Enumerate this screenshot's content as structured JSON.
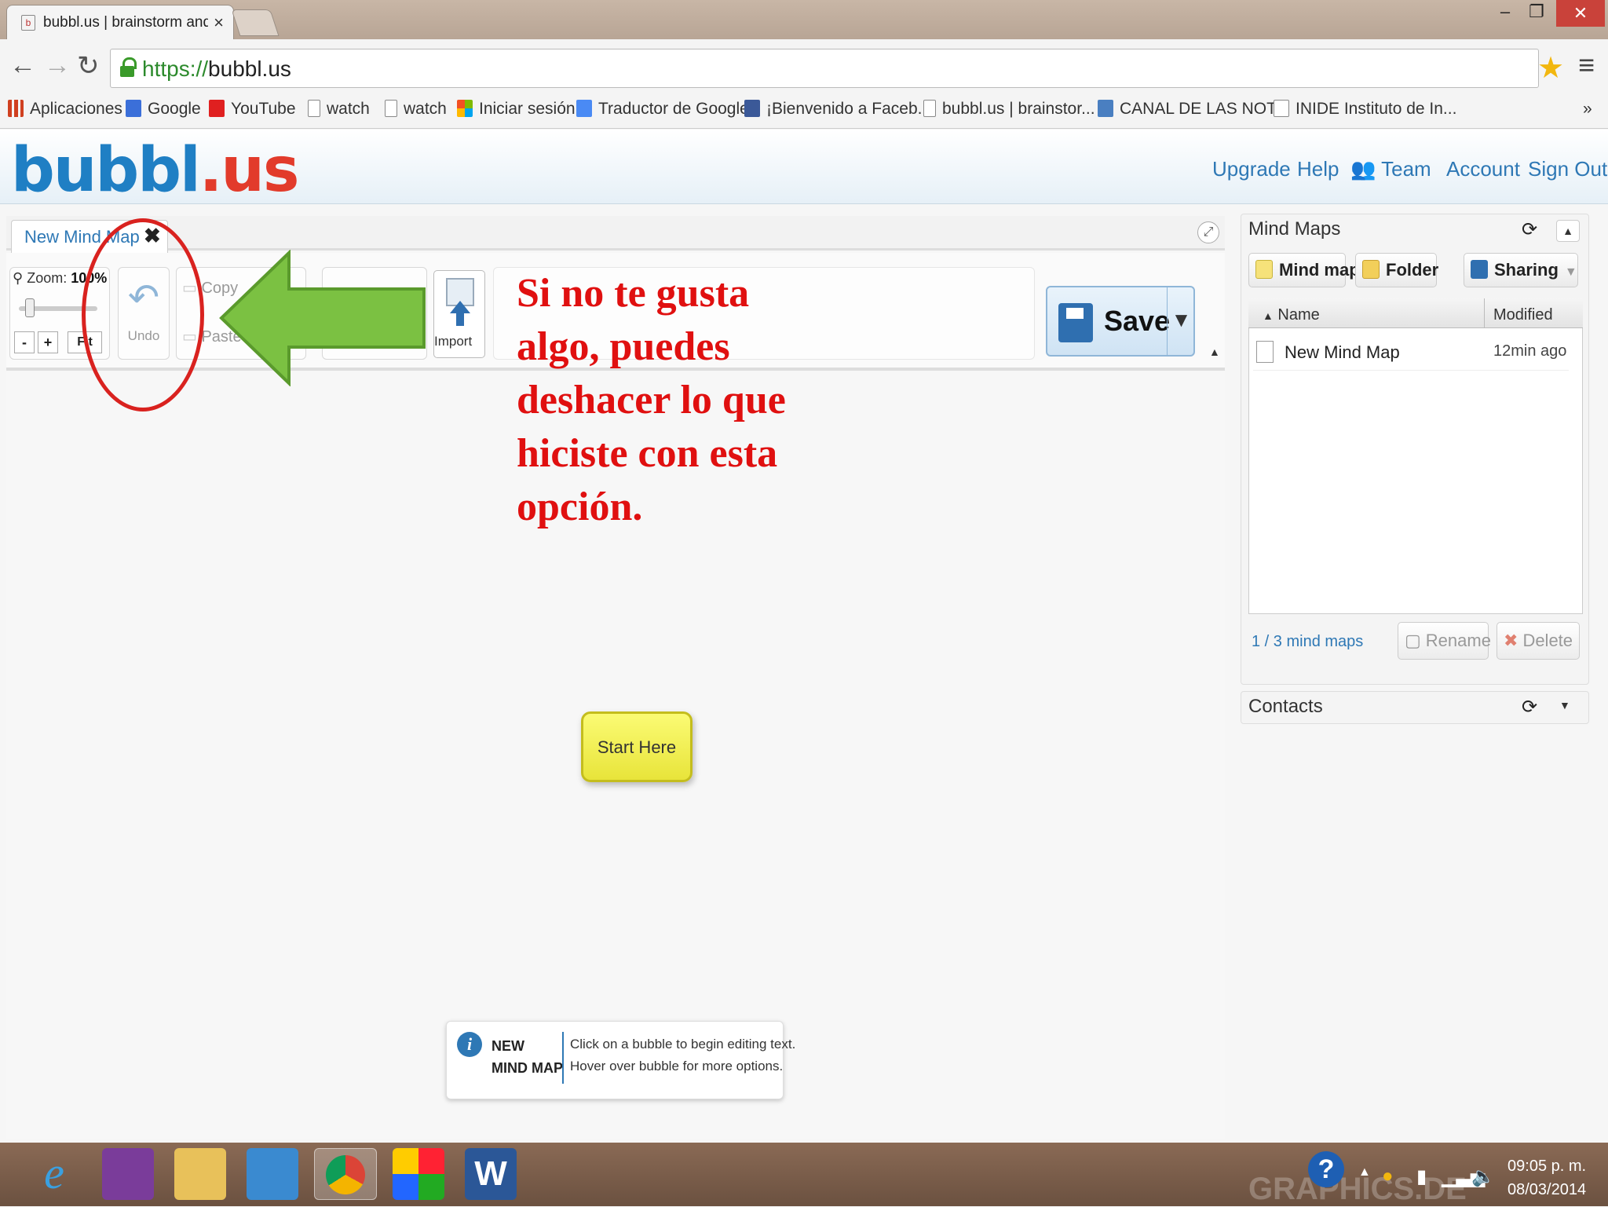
{
  "browser": {
    "tab_title": "bubbl.us | brainstorm and",
    "tab_close": "×",
    "url_scheme": "https://",
    "url_host": "bubbl.us",
    "window_controls": {
      "minimize": "–",
      "restore": "❐",
      "close": "✕"
    },
    "bookmarks": [
      {
        "label": "Aplicaciones",
        "icon_color": "#d04020"
      },
      {
        "label": "Google",
        "icon_color": "#3b6fd9"
      },
      {
        "label": "YouTube",
        "icon_color": "#e02020"
      },
      {
        "label": "watch",
        "icon_color": "#ffffff"
      },
      {
        "label": "watch",
        "icon_color": "#ffffff"
      },
      {
        "label": "Iniciar sesión",
        "icon_color": "#f25022"
      },
      {
        "label": "Traductor de Google",
        "icon_color": "#4a8af4"
      },
      {
        "label": "¡Bienvenido a Faceb...",
        "icon_color": "#3b5998"
      },
      {
        "label": "bubbl.us | brainstor...",
        "icon_color": "#ffffff"
      },
      {
        "label": "CANAL DE LAS NOT...",
        "icon_color": "#4a7fc1"
      },
      {
        "label": "INIDE Instituto de In...",
        "icon_color": "#ffffff"
      }
    ],
    "bookmarks_more": "»"
  },
  "app": {
    "logo_part1": "bubbl",
    "logo_part2": ".us",
    "nav": {
      "upgrade": "Upgrade",
      "help": "Help",
      "team": "Team",
      "account": "Account",
      "sign_out": "Sign Out"
    }
  },
  "editor": {
    "tab_title": "New Mind Map",
    "tab_close": "✖",
    "zoom_label": "Zoom:",
    "zoom_value": "100%",
    "zoom_minus": "-",
    "zoom_plus": "+",
    "zoom_fit": "Fit",
    "undo_label": "Undo",
    "copy_label": "Copy",
    "paste_label": "Paste",
    "import_label": "Import",
    "save_label": "Save",
    "save_dropdown": "▼",
    "toolbar_collapse": "▲",
    "bubble_text": "Start Here",
    "info_title_line1": "NEW",
    "info_title_line2": "MIND MAP",
    "info_line1": "Click on a bubble to begin editing text.",
    "info_line2": "Hover over bubble for more options."
  },
  "annotation": {
    "text_lines": [
      "Si no te gusta",
      "algo, puedes",
      "deshacer lo que",
      "hiciste con esta",
      "opción."
    ],
    "color": "#e01010"
  },
  "sidebar": {
    "mind_maps_title": "Mind Maps",
    "btn_mind_map": "Mind map",
    "btn_folder": "Folder",
    "btn_sharing": "Sharing",
    "col_name": "Name",
    "col_modified": "Modified",
    "files": [
      {
        "name": "New Mind Map",
        "modified": "12min ago"
      }
    ],
    "count": "1 / 3 mind maps",
    "btn_rename": "Rename",
    "btn_delete": "Delete",
    "contacts_title": "Contacts"
  },
  "taskbar": {
    "time": "09:05 p. m.",
    "date": "08/03/2014",
    "watermark": "GRAPHICS.DE"
  }
}
